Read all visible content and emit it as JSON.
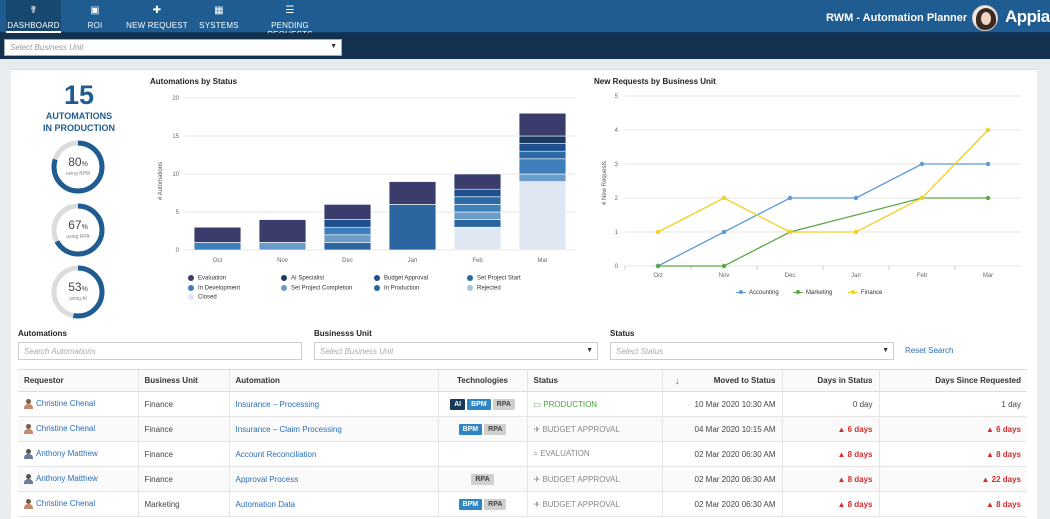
{
  "nav": {
    "items": [
      {
        "label": "DASHBOARD",
        "icon": "dashboard-icon",
        "glyph": "☤"
      },
      {
        "label": "ROI",
        "icon": "money-icon",
        "glyph": "▣"
      },
      {
        "label": "NEW REQUEST",
        "icon": "plus-icon",
        "glyph": "✚"
      },
      {
        "label": "SYSTEMS",
        "icon": "grid-icon",
        "glyph": "▦"
      },
      {
        "label": "PENDING REQUESTS",
        "icon": "list-icon",
        "glyph": "☰"
      }
    ],
    "app_title": "RWM - Automation Planner",
    "brand": "Appian"
  },
  "business_unit_select": {
    "placeholder": "Select Business Unit"
  },
  "summary": {
    "count": "15",
    "label_line1": "AUTOMATIONS",
    "label_line2": "IN PRODUCTION",
    "gauges": [
      {
        "pct": 80,
        "pct_text": "80",
        "sub": "using BPM"
      },
      {
        "pct": 67,
        "pct_text": "67",
        "sub": "using RPA"
      },
      {
        "pct": 53,
        "pct_text": "53",
        "sub": "using AI"
      }
    ],
    "color": "#1e5c91"
  },
  "chart_data": [
    {
      "type": "bar",
      "title": "Automations by Status",
      "ylabel": "# Automations",
      "ylim": [
        0,
        20
      ],
      "yticks": [
        0,
        5,
        10,
        15,
        20
      ],
      "categories": [
        "Oct",
        "Nov",
        "Dec",
        "Jan",
        "Feb",
        "Mar"
      ],
      "stacked": true,
      "series": [
        {
          "name": "Evaluation",
          "color": "#3a3d6b",
          "values": [
            2,
            3,
            2,
            3,
            2,
            3
          ]
        },
        {
          "name": "AI Specialist",
          "color": "#1c3b61",
          "values": [
            0,
            0,
            0,
            0,
            0,
            1
          ]
        },
        {
          "name": "Budget Approval",
          "color": "#1e4f8c",
          "values": [
            0,
            0,
            1,
            0,
            1,
            1
          ]
        },
        {
          "name": "Set Project Start",
          "color": "#2a6aa6",
          "values": [
            0,
            0,
            0,
            0,
            1,
            1
          ]
        },
        {
          "name": "In Development",
          "color": "#3d7fba",
          "values": [
            1,
            0,
            1,
            0,
            1,
            2
          ]
        },
        {
          "name": "Set Project Completion",
          "color": "#6b9bc9",
          "values": [
            0,
            1,
            1,
            0,
            1,
            1
          ]
        },
        {
          "name": "In Production",
          "color": "#2c66a0",
          "values": [
            0,
            0,
            1,
            6,
            1,
            0
          ]
        },
        {
          "name": "Rejected",
          "color": "#a9c6dd",
          "values": [
            0,
            0,
            0,
            0,
            0,
            0
          ]
        },
        {
          "name": "Closed",
          "color": "#dfe8f2",
          "values": [
            0,
            0,
            0,
            0,
            3,
            9
          ]
        }
      ],
      "legend": "bottom",
      "grid": true
    },
    {
      "type": "line",
      "title": "New Requests by Business Unit",
      "ylabel": "# New Requests",
      "ylim": [
        0,
        5
      ],
      "yticks": [
        0,
        1,
        2,
        3,
        4,
        5
      ],
      "categories": [
        "Oct",
        "Nov",
        "Dec",
        "Jan",
        "Feb",
        "Mar"
      ],
      "series": [
        {
          "name": "Accounting",
          "color": "#5b9bd5",
          "values": [
            0,
            1,
            2,
            2,
            3,
            3
          ]
        },
        {
          "name": "Marketing",
          "color": "#5aa843",
          "values": [
            0,
            0,
            1,
            null,
            2,
            2
          ]
        },
        {
          "name": "Finance",
          "color": "#f2d024",
          "values": [
            1,
            2,
            1,
            1,
            2,
            4
          ]
        }
      ],
      "legend": "bottom",
      "grid": true
    }
  ],
  "filters": {
    "automations_label": "Automations",
    "automations_placeholder": "Search Automations",
    "bu_label": "Businesss Unit",
    "bu_placeholder": "Select Business Unit",
    "status_label": "Status",
    "status_placeholder": "Select Status",
    "reset": "Reset Search"
  },
  "table": {
    "headers": [
      "Requestor",
      "Business Unit",
      "Automation",
      "Technologies",
      "Status",
      "Moved to Status",
      "Days in Status",
      "Days Since Requested"
    ],
    "rows": [
      {
        "requestor": "Christine Chenal",
        "gender": "f",
        "unit": "Finance",
        "automation": "Insurance – Processing",
        "tech": [
          "AI",
          "BPM",
          "RPA"
        ],
        "status": "PRODUCTION",
        "status_icon": "▭",
        "prod": true,
        "moved": "10 Mar 2020 10:30 AM",
        "days_in": "0 day",
        "days_in_warn": false,
        "since": "1 day",
        "since_warn": false
      },
      {
        "requestor": "Christine Chenal",
        "gender": "f",
        "unit": "Finance",
        "automation": "Insurance – Claim Processing",
        "tech": [
          "BPM",
          "RPA"
        ],
        "status": "BUDGET APPROVAL",
        "status_icon": "✈",
        "prod": false,
        "moved": "04 Mar 2020 10:15 AM",
        "days_in": "6 days",
        "days_in_warn": true,
        "since": "6 days",
        "since_warn": true
      },
      {
        "requestor": "Anthony Matthew",
        "gender": "m",
        "unit": "Finance",
        "automation": "Account Reconciliation",
        "tech": [],
        "status": "EVALUATION",
        "status_icon": "⌕",
        "prod": false,
        "moved": "02 Mar 2020 06:30 AM",
        "days_in": "8 days",
        "days_in_warn": true,
        "since": "8 days",
        "since_warn": true
      },
      {
        "requestor": "Anthony Matthew",
        "gender": "m",
        "unit": "Finance",
        "automation": "Approval Process",
        "tech": [
          "RPA"
        ],
        "status": "BUDGET APPROVAL",
        "status_icon": "✈",
        "prod": false,
        "moved": "02 Mar 2020 06:30 AM",
        "days_in": "8 days",
        "days_in_warn": true,
        "since": "22 days",
        "since_warn": true
      },
      {
        "requestor": "Christine Chenal",
        "gender": "f",
        "unit": "Marketing",
        "automation": "Automation Data",
        "tech": [
          "BPM",
          "RPA"
        ],
        "status": "BUDGET APPROVAL",
        "status_icon": "✈",
        "prod": false,
        "moved": "02 Mar 2020 06:30 AM",
        "days_in": "8 days",
        "days_in_warn": true,
        "since": "8 days",
        "since_warn": true
      }
    ]
  }
}
